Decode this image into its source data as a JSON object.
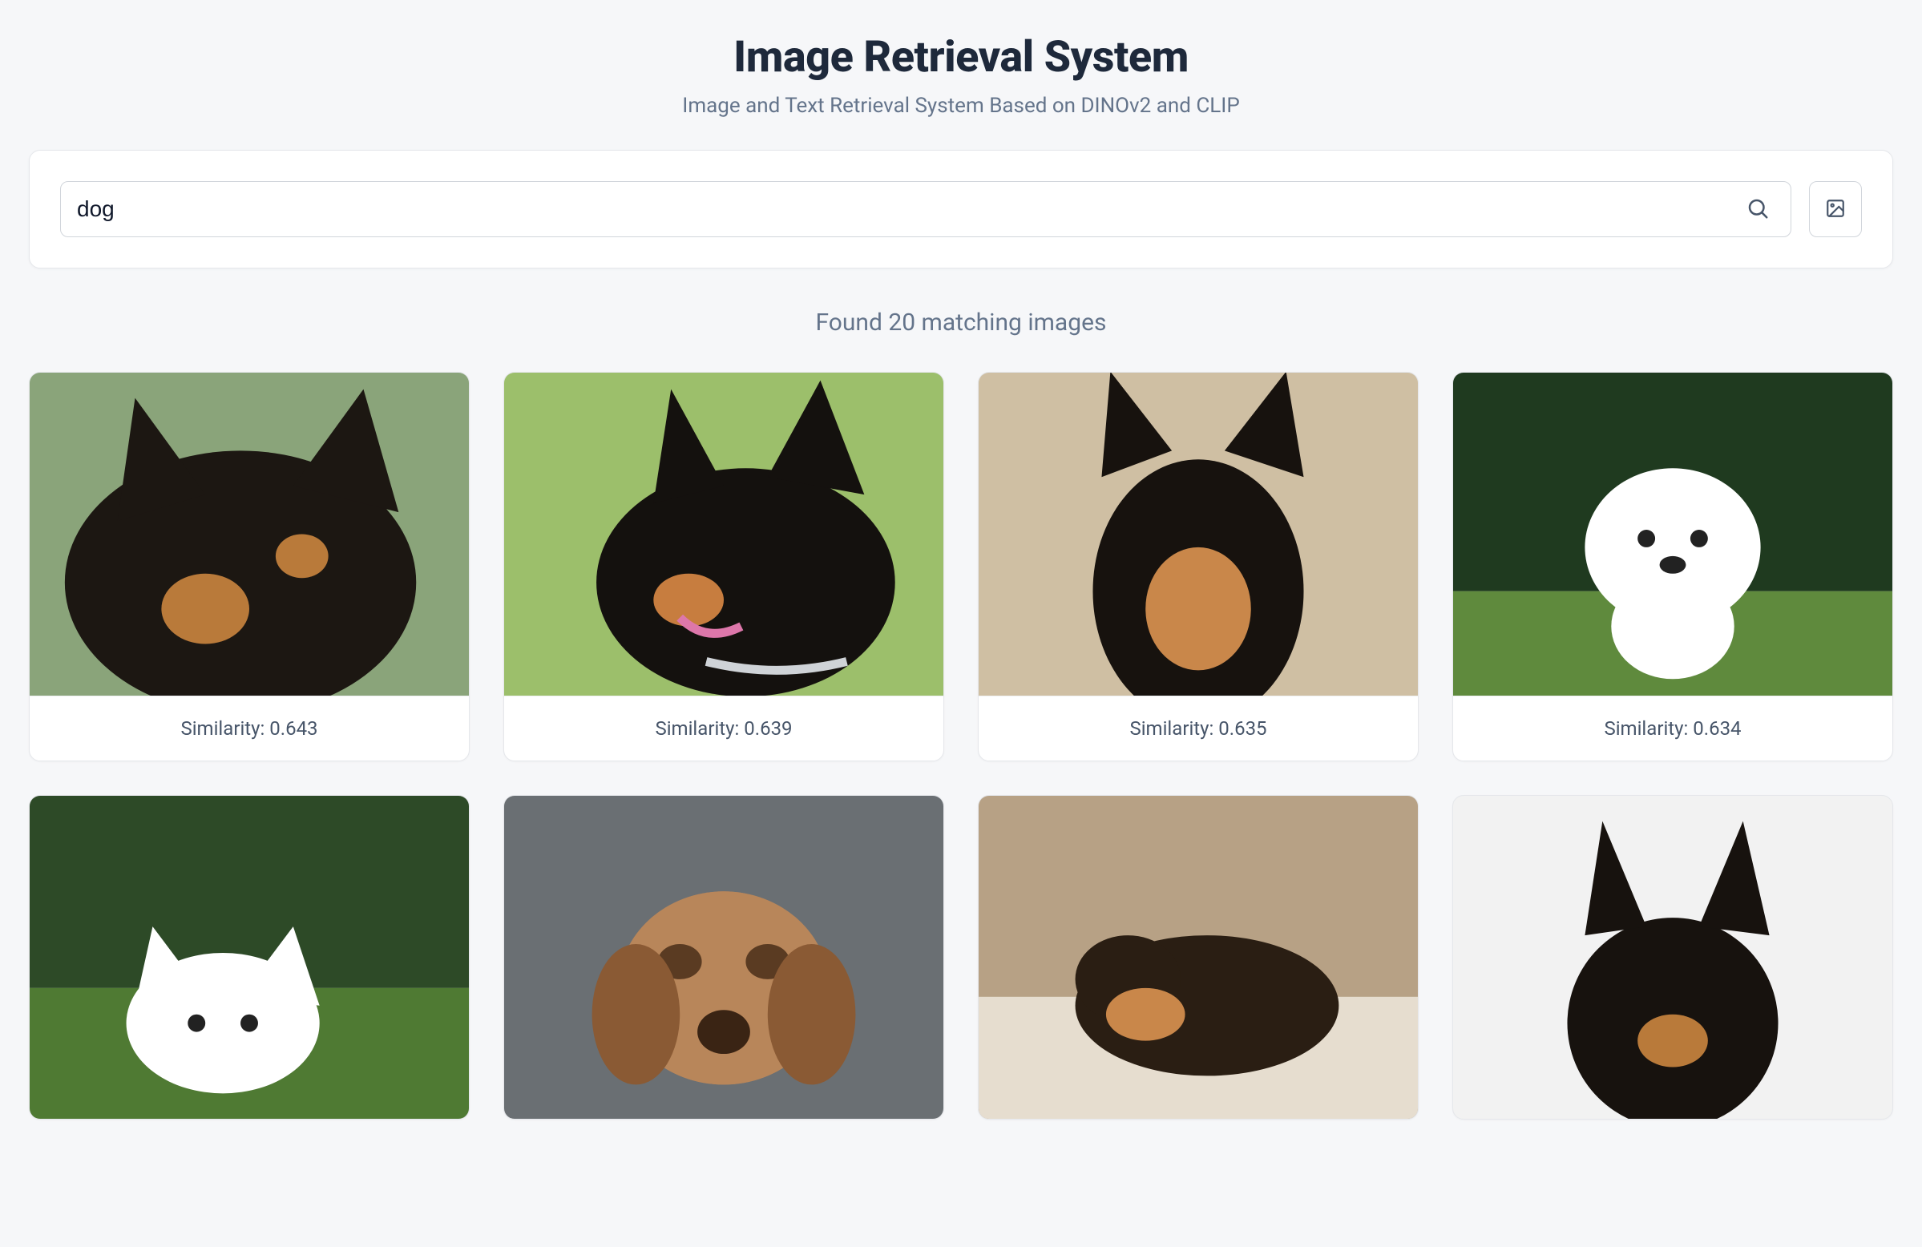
{
  "header": {
    "title": "Image Retrieval System",
    "subtitle": "Image and Text Retrieval System Based on DINOv2 and CLIP"
  },
  "search": {
    "value": "dog",
    "placeholder": ""
  },
  "results": {
    "summary": "Found 20 matching images",
    "similarity_label": "Similarity: ",
    "items": [
      {
        "similarity": "0.643"
      },
      {
        "similarity": "0.639"
      },
      {
        "similarity": "0.635"
      },
      {
        "similarity": "0.634"
      },
      {
        "similarity": ""
      },
      {
        "similarity": ""
      },
      {
        "similarity": ""
      },
      {
        "similarity": ""
      }
    ]
  }
}
